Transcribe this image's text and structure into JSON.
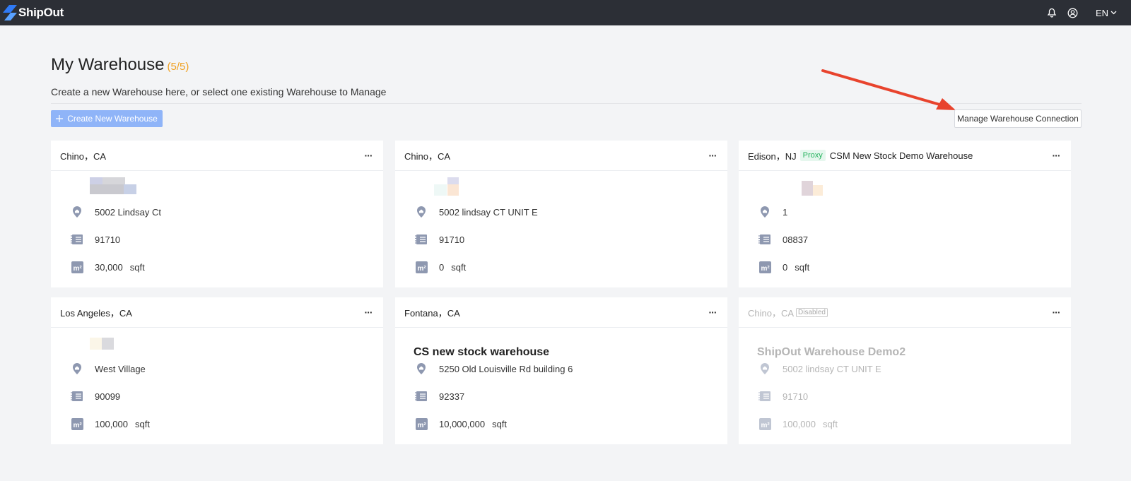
{
  "header": {
    "logo_text": "ShipOut",
    "language": "EN",
    "icons": [
      "bell-icon",
      "user-icon",
      "chevron-down-icon"
    ]
  },
  "page": {
    "title": "My Warehouse",
    "count": "(5/5)",
    "subtitle": "Create a new Warehouse here, or select one existing Warehouse to Manage",
    "create_button": "Create New Warehouse",
    "manage_button": "Manage Warehouse Connection"
  },
  "colors": {
    "topbar": "#2c2f36",
    "accent_count": "#f0a020",
    "create_button": "#8fb4f8",
    "proxy_badge": "#27b35f",
    "arrow": "#e8432d"
  },
  "warehouses": [
    {
      "location": "Chino，CA",
      "name": "",
      "address": "5002 Lindsay Ct",
      "zip": "91710",
      "area": "30,000",
      "unit": "sqft"
    },
    {
      "location": "Chino，CA",
      "name": "",
      "address": "5002 lindsay CT UNIT E",
      "zip": "91710",
      "area": "0",
      "unit": "sqft"
    },
    {
      "location": "Edison，NJ",
      "badge": "Proxy",
      "title_extra": "CSM New Stock Demo Warehouse",
      "name": "",
      "address": "1",
      "zip": "08837",
      "area": "0",
      "unit": "sqft"
    },
    {
      "location": "Los Angeles，CA",
      "name": "",
      "address": "West Village",
      "zip": "90099",
      "area": "100,000",
      "unit": "sqft"
    },
    {
      "location": "Fontana，CA",
      "name": "CS new stock warehouse",
      "address": "5250 Old Louisville Rd building 6",
      "zip": "92337",
      "area": "10,000,000",
      "unit": "sqft"
    },
    {
      "location": "Chino，CA",
      "badge": "Disabled",
      "name": "ShipOut Warehouse Demo2",
      "address": "5002 lindsay CT UNIT E",
      "zip": "91710",
      "area": "100,000",
      "unit": "sqft"
    }
  ]
}
